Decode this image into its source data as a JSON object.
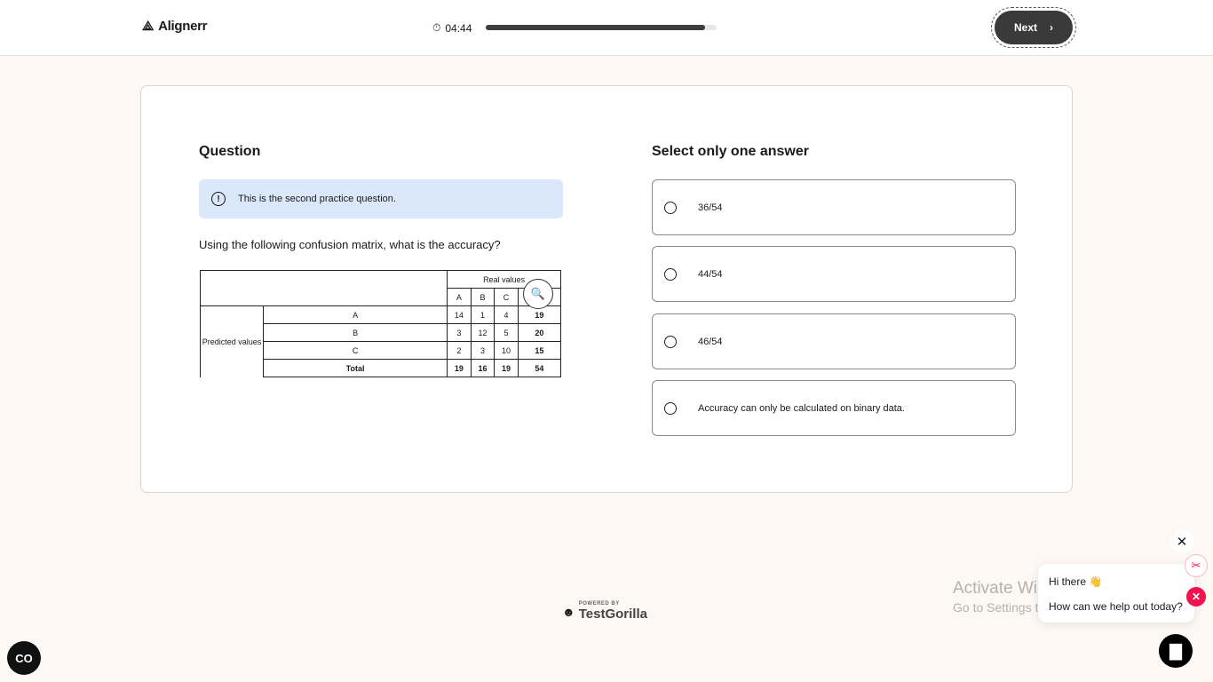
{
  "header": {
    "brand": "Alignerr",
    "timer": "04:44",
    "progress_percent": 95,
    "next_label": "Next"
  },
  "question": {
    "heading": "Question",
    "info": "This is the second practice question.",
    "prompt": "Using the following confusion matrix, what is the accuracy?",
    "matrix": {
      "real_label": "Real values",
      "predicted_label": "Predicted values",
      "columns": [
        "A",
        "B",
        "C",
        "Total"
      ],
      "rows": [
        {
          "label": "A",
          "values": [
            "14",
            "1",
            "4",
            "19"
          ]
        },
        {
          "label": "B",
          "values": [
            "3",
            "12",
            "5",
            "20"
          ]
        },
        {
          "label": "C",
          "values": [
            "2",
            "3",
            "10",
            "15"
          ]
        },
        {
          "label": "Total",
          "values": [
            "19",
            "16",
            "19",
            "54"
          ]
        }
      ]
    }
  },
  "answers": {
    "heading": "Select only one answer",
    "options": [
      "36/54",
      "44/54",
      "46/54",
      "Accuracy can only be calculated on binary data."
    ]
  },
  "footer": {
    "powered_by": "POWERED BY",
    "brand": "TestGorilla"
  },
  "watermark": {
    "title": "Activate Windows",
    "subtitle": "Go to Settings to activate Windows."
  },
  "chat": {
    "greeting": "Hi there 👋",
    "message": "How can we help out today?"
  },
  "colors": {
    "accent": "#3a3a3a",
    "info_bg": "#dbe7fb",
    "chat_red": "#f0134d"
  }
}
